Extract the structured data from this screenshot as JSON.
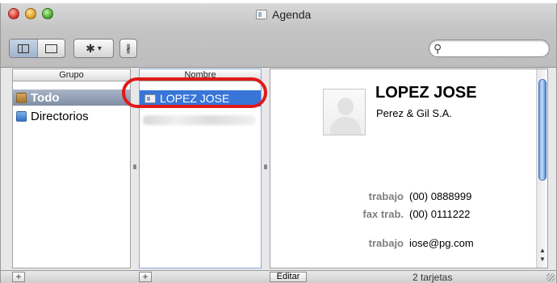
{
  "window": {
    "title": "Agenda"
  },
  "toolbar": {
    "bluetooth_symbol": "∦",
    "gear_symbol": "✱",
    "menu_caret": "▾"
  },
  "search": {
    "value": ""
  },
  "columns": {
    "group_header": "Grupo",
    "name_header": "Nombre"
  },
  "groups": [
    {
      "label": "Todo"
    },
    {
      "label": "Directorios"
    }
  ],
  "names": [
    {
      "label": "LOPEZ JOSE"
    }
  ],
  "contact": {
    "name": "LOPEZ JOSE",
    "company": "Perez & Gil S.A.",
    "fields": [
      {
        "label": "trabajo",
        "value": "(00) 0888999"
      },
      {
        "label": "fax trab.",
        "value": "(00) 0111222"
      },
      {
        "label": "trabajo",
        "value": "iose@pg.com"
      }
    ]
  },
  "bottom": {
    "add_symbol": "+",
    "edit_label": "Editar",
    "count": "2 tarjetas"
  },
  "colors": {
    "selection_blue": "#3875d7",
    "highlight_ring": "#e01a1a"
  }
}
